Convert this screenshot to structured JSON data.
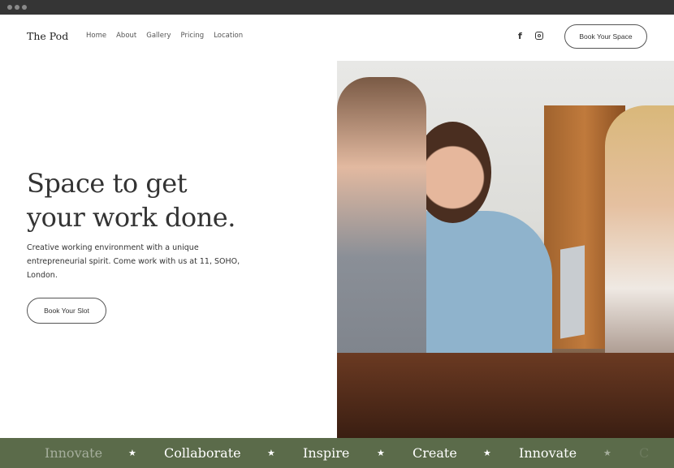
{
  "header": {
    "logo": "The Pod",
    "nav": [
      "Home",
      "About",
      "Gallery",
      "Pricing",
      "Location"
    ],
    "social": [
      "facebook-icon",
      "instagram-icon"
    ],
    "cta": "Book Your Space"
  },
  "hero": {
    "title_line1": "Space to get",
    "title_line2": "your work done.",
    "description": "Creative working environment with a unique entrepreneurial spirit. Come work with us at 11, SOHO, London.",
    "cta": "Book Your Slot"
  },
  "banner": {
    "items": [
      "Innovate",
      "Collaborate",
      "Inspire",
      "Create",
      "Innovate",
      "C"
    ],
    "separator": "★",
    "color": "#5b6b4a"
  }
}
